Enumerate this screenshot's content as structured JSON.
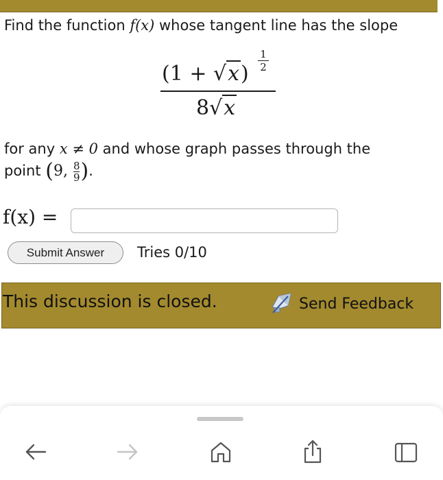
{
  "question": {
    "intro_before": "Find the function ",
    "intro_fx": "f(x)",
    "intro_after": " whose tangent line has the slope",
    "formula": {
      "numerator_open": "(1 + ",
      "numerator_radicand": "x",
      "numerator_close": ")",
      "exponent_num": "1",
      "exponent_den": "2",
      "denominator_coef": "8",
      "denominator_radicand": "x"
    },
    "condition_before": "for any ",
    "condition_math": "x ≠ 0",
    "condition_after": " and whose graph passes through the",
    "point_before": "point ",
    "point_open": "(",
    "point_x": "9, ",
    "point_num": "8",
    "point_den": "9",
    "point_close": ")",
    "point_after": "."
  },
  "answer": {
    "label": "f(x) =",
    "value": "",
    "placeholder": ""
  },
  "controls": {
    "submit_label": "Submit Answer",
    "tries": "Tries 0/10"
  },
  "banner": {
    "closed_text": "This discussion is closed.",
    "feedback_label": "Send Feedback"
  },
  "browser_nav": {
    "icons": [
      "back-arrow-icon",
      "forward-arrow-icon",
      "home-icon",
      "share-icon",
      "tabs-icon"
    ]
  },
  "colors": {
    "banner": "#a38a2e",
    "banner_border": "#7a6620",
    "button_bg": "#efefef",
    "nav_active": "#555555",
    "nav_disabled": "#c4c4c4"
  }
}
